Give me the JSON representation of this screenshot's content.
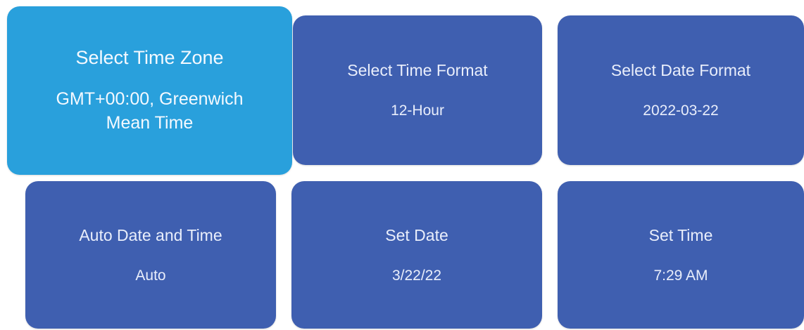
{
  "colors": {
    "tile": "#3f5fb0",
    "tile_selected": "#29a0dc",
    "text": "#e9eefb",
    "background": "#ffffff"
  },
  "tiles": [
    {
      "title": "Select Time Zone",
      "value_line1": "GMT+00:00, Greenwich",
      "value_line2": "Mean Time",
      "selected": true
    },
    {
      "title": "Select Time Format",
      "value": "12-Hour",
      "selected": false
    },
    {
      "title": "Select Date Format",
      "value": "2022-03-22",
      "selected": false
    },
    {
      "title": "Auto Date and Time",
      "value": "Auto",
      "selected": false
    },
    {
      "title": "Set Date",
      "value": "3/22/22",
      "selected": false
    },
    {
      "title": "Set Time",
      "value": "7:29 AM",
      "selected": false
    }
  ]
}
